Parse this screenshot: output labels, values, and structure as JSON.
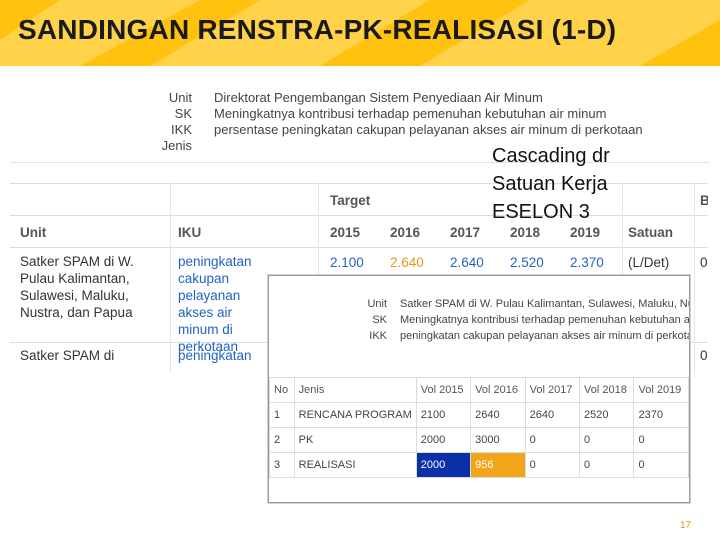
{
  "slide": {
    "title": "SANDINGAN RENSTRA-PK-REALISASI (1-D)",
    "page_number": "17",
    "banner_color": "#ffc20e"
  },
  "unit_info": [
    {
      "label": "Unit",
      "value": "Direktorat Pengembangan Sistem Penyediaan Air Minum"
    },
    {
      "label": "SK",
      "value": "Meningkatnya kontribusi terhadap pemenuhan kebutuhan air minum"
    },
    {
      "label": "IKK",
      "value": "persentase peningkatan cakupan pelayanan akses air minum di perkotaan"
    },
    {
      "label": "Jenis",
      "value": ""
    }
  ],
  "iku_table": {
    "headers": {
      "unit": "Unit",
      "iku": "IKU",
      "target": "Target",
      "satuan": "Satuan",
      "extra": "B"
    },
    "years": [
      "2015",
      "2016",
      "2017",
      "2018",
      "2019"
    ],
    "rows": [
      {
        "unit": "Satker SPAM di W. Pulau Kalimantan, Sulawesi, Maluku, Nustra, dan Papua",
        "iku": "peningkatan cakupan pelayanan akses air minum di perkotaan",
        "values": [
          "2.100",
          "2.640",
          "2.640",
          "2.520",
          "2.370"
        ],
        "satuan": "(L/Det)",
        "extra": "0"
      },
      {
        "unit": "Satker SPAM di",
        "iku": "peningkatan",
        "extra": "0"
      }
    ]
  },
  "callout": {
    "lines": [
      "Cascading dr",
      "Satuan Kerja",
      "ESELON 3"
    ]
  },
  "overlay": {
    "info": [
      {
        "label": "Unit",
        "value": "Satker SPAM di W. Pulau Kalimantan, Sulawesi, Maluku, Nustra, dan Papua"
      },
      {
        "label": "SK",
        "value": "Meningkatnya kontribusi terhadap pemenuhan kebutuhan air minum"
      },
      {
        "label": "IKK",
        "value": "peningkatan cakupan pelayanan akses air minum di perkotaan"
      }
    ],
    "table": {
      "headers": [
        "No",
        "Jenis",
        "Vol 2015",
        "Vol 2016",
        "Vol 2017",
        "Vol 2018",
        "Vol 2019"
      ],
      "rows": [
        [
          "1",
          "RENCANA PROGRAM",
          "2100",
          "2640",
          "2640",
          "2520",
          "2370"
        ],
        [
          "2",
          "PK",
          "2000",
          "3000",
          "0",
          "0",
          "0"
        ],
        [
          "3",
          "REALISASI",
          "2000",
          "956",
          "0",
          "0",
          "0"
        ]
      ],
      "highlight_colors": {
        "realisasi_2015": "#0b2fa8",
        "realisasi_2016": "#f2a51b"
      }
    }
  }
}
